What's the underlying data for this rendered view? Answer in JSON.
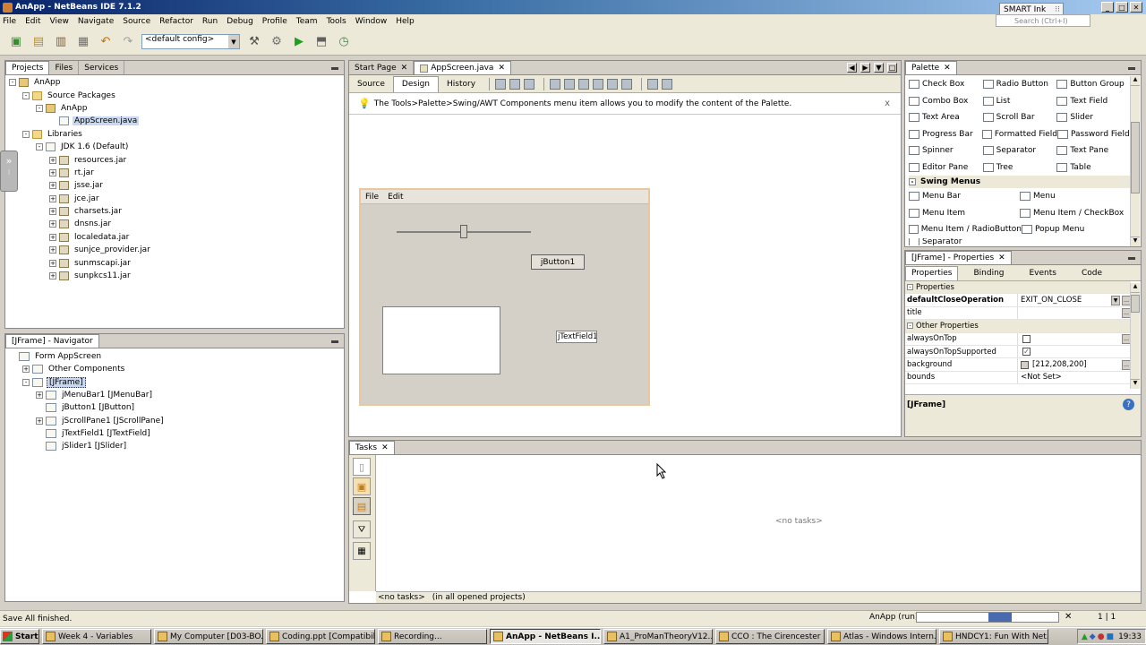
{
  "window": {
    "title": "AnApp - NetBeans IDE 7.1.2",
    "smart_ink": "SMART Ink",
    "search_placeholder": "Search (Ctrl+I)"
  },
  "menu": [
    "File",
    "Edit",
    "View",
    "Navigate",
    "Source",
    "Refactor",
    "Run",
    "Debug",
    "Profile",
    "Team",
    "Tools",
    "Window",
    "Help"
  ],
  "toolbar": {
    "config": "<default config>"
  },
  "projects": {
    "tabs": [
      "Projects",
      "Files",
      "Services"
    ],
    "tree": [
      {
        "label": "AnApp",
        "level": 0,
        "icon": "project-icon",
        "exp": "-"
      },
      {
        "label": "Source Packages",
        "level": 1,
        "icon": "folder-icon",
        "exp": "-"
      },
      {
        "label": "AnApp",
        "level": 2,
        "icon": "package-icon",
        "exp": "-"
      },
      {
        "label": "AppScreen.java",
        "level": 3,
        "icon": "java-file-icon",
        "exp": "",
        "selected": true
      },
      {
        "label": "Libraries",
        "level": 1,
        "icon": "folder-icon",
        "exp": "-"
      },
      {
        "label": "JDK 1.6 (Default)",
        "level": 2,
        "icon": "jdk-icon",
        "exp": "-"
      },
      {
        "label": "resources.jar",
        "level": 3,
        "icon": "jar-icon",
        "exp": "+"
      },
      {
        "label": "rt.jar",
        "level": 3,
        "icon": "jar-icon",
        "exp": "+"
      },
      {
        "label": "jsse.jar",
        "level": 3,
        "icon": "jar-icon",
        "exp": "+"
      },
      {
        "label": "jce.jar",
        "level": 3,
        "icon": "jar-icon",
        "exp": "+"
      },
      {
        "label": "charsets.jar",
        "level": 3,
        "icon": "jar-icon",
        "exp": "+"
      },
      {
        "label": "dnsns.jar",
        "level": 3,
        "icon": "jar-icon",
        "exp": "+"
      },
      {
        "label": "localedata.jar",
        "level": 3,
        "icon": "jar-icon",
        "exp": "+"
      },
      {
        "label": "sunjce_provider.jar",
        "level": 3,
        "icon": "jar-icon",
        "exp": "+"
      },
      {
        "label": "sunmscapi.jar",
        "level": 3,
        "icon": "jar-icon",
        "exp": "+"
      },
      {
        "label": "sunpkcs11.jar",
        "level": 3,
        "icon": "jar-icon",
        "exp": "+"
      }
    ]
  },
  "navigator": {
    "title": "[JFrame] - Navigator",
    "tree": [
      {
        "label": "Form AppScreen",
        "level": 0,
        "exp": ""
      },
      {
        "label": "Other Components",
        "level": 1,
        "exp": "+"
      },
      {
        "label": "[JFrame]",
        "level": 1,
        "exp": "-",
        "selected": true
      },
      {
        "label": "jMenuBar1 [JMenuBar]",
        "level": 2,
        "exp": "+"
      },
      {
        "label": "jButton1 [JButton]",
        "level": 2,
        "exp": ""
      },
      {
        "label": "jScrollPane1 [JScrollPane]",
        "level": 2,
        "exp": "+"
      },
      {
        "label": "jTextField1 [JTextField]",
        "level": 2,
        "exp": ""
      },
      {
        "label": "jSlider1 [JSlider]",
        "level": 2,
        "exp": ""
      }
    ]
  },
  "editor": {
    "tabs": [
      "Start Page",
      "AppScreen.java"
    ],
    "view_tabs": [
      "Source",
      "Design",
      "History"
    ],
    "info": "The Tools>Palette>Swing/AWT Components menu item allows you to modify the content of the Palette.",
    "close": "x",
    "form": {
      "menus": [
        "File",
        "Edit"
      ],
      "button": "jButton1",
      "textfield": "jTextField1",
      "slider_value": 0.5
    }
  },
  "palette": {
    "title": "Palette",
    "rows": [
      [
        "Check Box",
        "Radio Button",
        "Button Group"
      ],
      [
        "Combo Box",
        "List",
        "Text Field"
      ],
      [
        "Text Area",
        "Scroll Bar",
        "Slider"
      ],
      [
        "Progress Bar",
        "Formatted Field",
        "Password Field"
      ],
      [
        "Spinner",
        "Separator",
        "Text Pane"
      ],
      [
        "Editor Pane",
        "Tree",
        "Table"
      ]
    ],
    "menus_header": "Swing Menus",
    "menu_rows": [
      [
        "Menu Bar",
        "Menu"
      ],
      [
        "Menu Item",
        "Menu Item / CheckBox"
      ],
      [
        "Menu Item / RadioButton",
        "Popup Menu"
      ],
      [
        "Separator",
        ""
      ]
    ]
  },
  "properties": {
    "title": "[JFrame] - Properties",
    "tabs": [
      "Properties",
      "Binding",
      "Events",
      "Code"
    ],
    "section1": "Properties",
    "rows1": [
      {
        "k": "defaultCloseOperation",
        "v": "EXIT_ON_CLOSE",
        "bold": true
      },
      {
        "k": "title",
        "v": ""
      }
    ],
    "section2": "Other Properties",
    "rows2": [
      {
        "k": "alwaysOnTop",
        "v": "",
        "chk": "off"
      },
      {
        "k": "alwaysOnTopSupported",
        "v": "",
        "chk": "on"
      },
      {
        "k": "background",
        "v": "[212,208,200]",
        "swatch": "#d4d0c8"
      },
      {
        "k": "bounds",
        "v": "<Not Set>"
      }
    ],
    "footer": "[JFrame]"
  },
  "tasks": {
    "tab": "Tasks",
    "empty": "<no tasks>",
    "status_left": "<no tasks>",
    "status_right": "(in all opened projects)"
  },
  "status": {
    "left": "Save All finished.",
    "project": "AnApp (run)",
    "position": "1 | 1"
  },
  "taskbar": {
    "start": "Start",
    "items": [
      "Week 4 - Variables",
      "My Computer [D03-BO...",
      "Coding.ppt [Compatibili...",
      "Recording...",
      "AnApp - NetBeans I...",
      "A1_ProManTheoryV12....",
      "CCO : The Cirencester ...",
      "Atlas - Windows Intern...",
      "HNDCY1: Fun With Net..."
    ],
    "active": 4,
    "clock": "19:33"
  }
}
